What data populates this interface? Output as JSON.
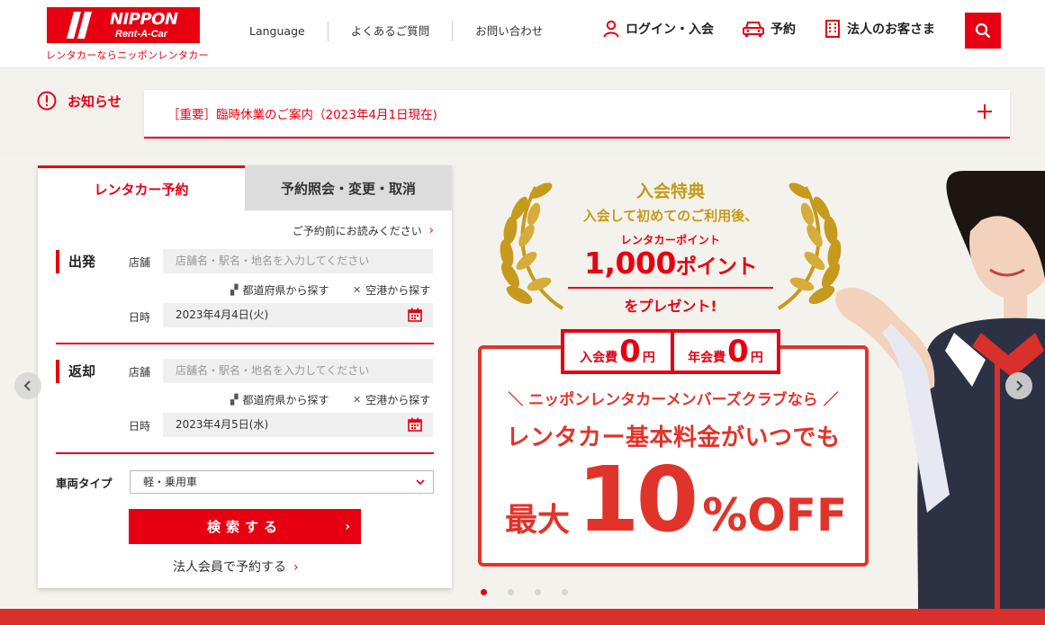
{
  "header": {
    "logo_text": "NIPPON",
    "logo_sub": "Rent-A-Car",
    "tagline": "レンタカーならニッポンレンタカー",
    "top_links": [
      "Language",
      "よくあるご質問",
      "お問い合わせ"
    ],
    "main_links": {
      "login": "ログイン・入会",
      "reserve": "予約",
      "corporate": "法人のお客さま"
    }
  },
  "notice": {
    "label": "お知らせ",
    "text": "［重要］臨時休業のご案内（2023年4月1日現在)"
  },
  "booking": {
    "tab_active": "レンタカー予約",
    "tab_inactive": "予約照会・変更・取消",
    "read_before": "ご予約前にお読みください",
    "departure": {
      "title": "出発",
      "store_label": "店舗",
      "store_placeholder": "店舗名・駅名・地名を入力してください",
      "by_prefecture": "都道府県から探す",
      "by_airport": "空港から探す",
      "datetime_label": "日時",
      "date_value": "2023年4月4日(火)"
    },
    "return": {
      "title": "返却",
      "store_label": "店舗",
      "store_placeholder": "店舗名・駅名・地名を入力してください",
      "by_prefecture": "都道府県から探す",
      "by_airport": "空港から探す",
      "datetime_label": "日時",
      "date_value": "2023年4月5日(水)"
    },
    "vehicle_type_label": "車両タイプ",
    "vehicle_type_value": "軽・乗用車",
    "search_button": "検索する",
    "corporate_link": "法人会員で予約する"
  },
  "banner": {
    "title": "入会特典",
    "line2": "入会して初めてのご利用後、",
    "line3": "レンタカーポイント",
    "points": "1,000",
    "points_unit": "ポイント",
    "line5": "をプレゼント!",
    "fee1_label": "入会費",
    "fee1_value": "0",
    "fee2_label": "年会費",
    "fee2_value": "0",
    "yen": "円",
    "club": "ニッポンレンタカーメンバーズクラブなら",
    "basic": "レンタカー基本料金がいつでも",
    "max": "最大",
    "discount": "10",
    "off": "%OFF"
  },
  "carousel": {
    "dot_count": 4,
    "active_index": 0
  },
  "colors": {
    "brand_red": "#e60012",
    "gold": "#c69a1d",
    "background": "#f3f1ec"
  }
}
